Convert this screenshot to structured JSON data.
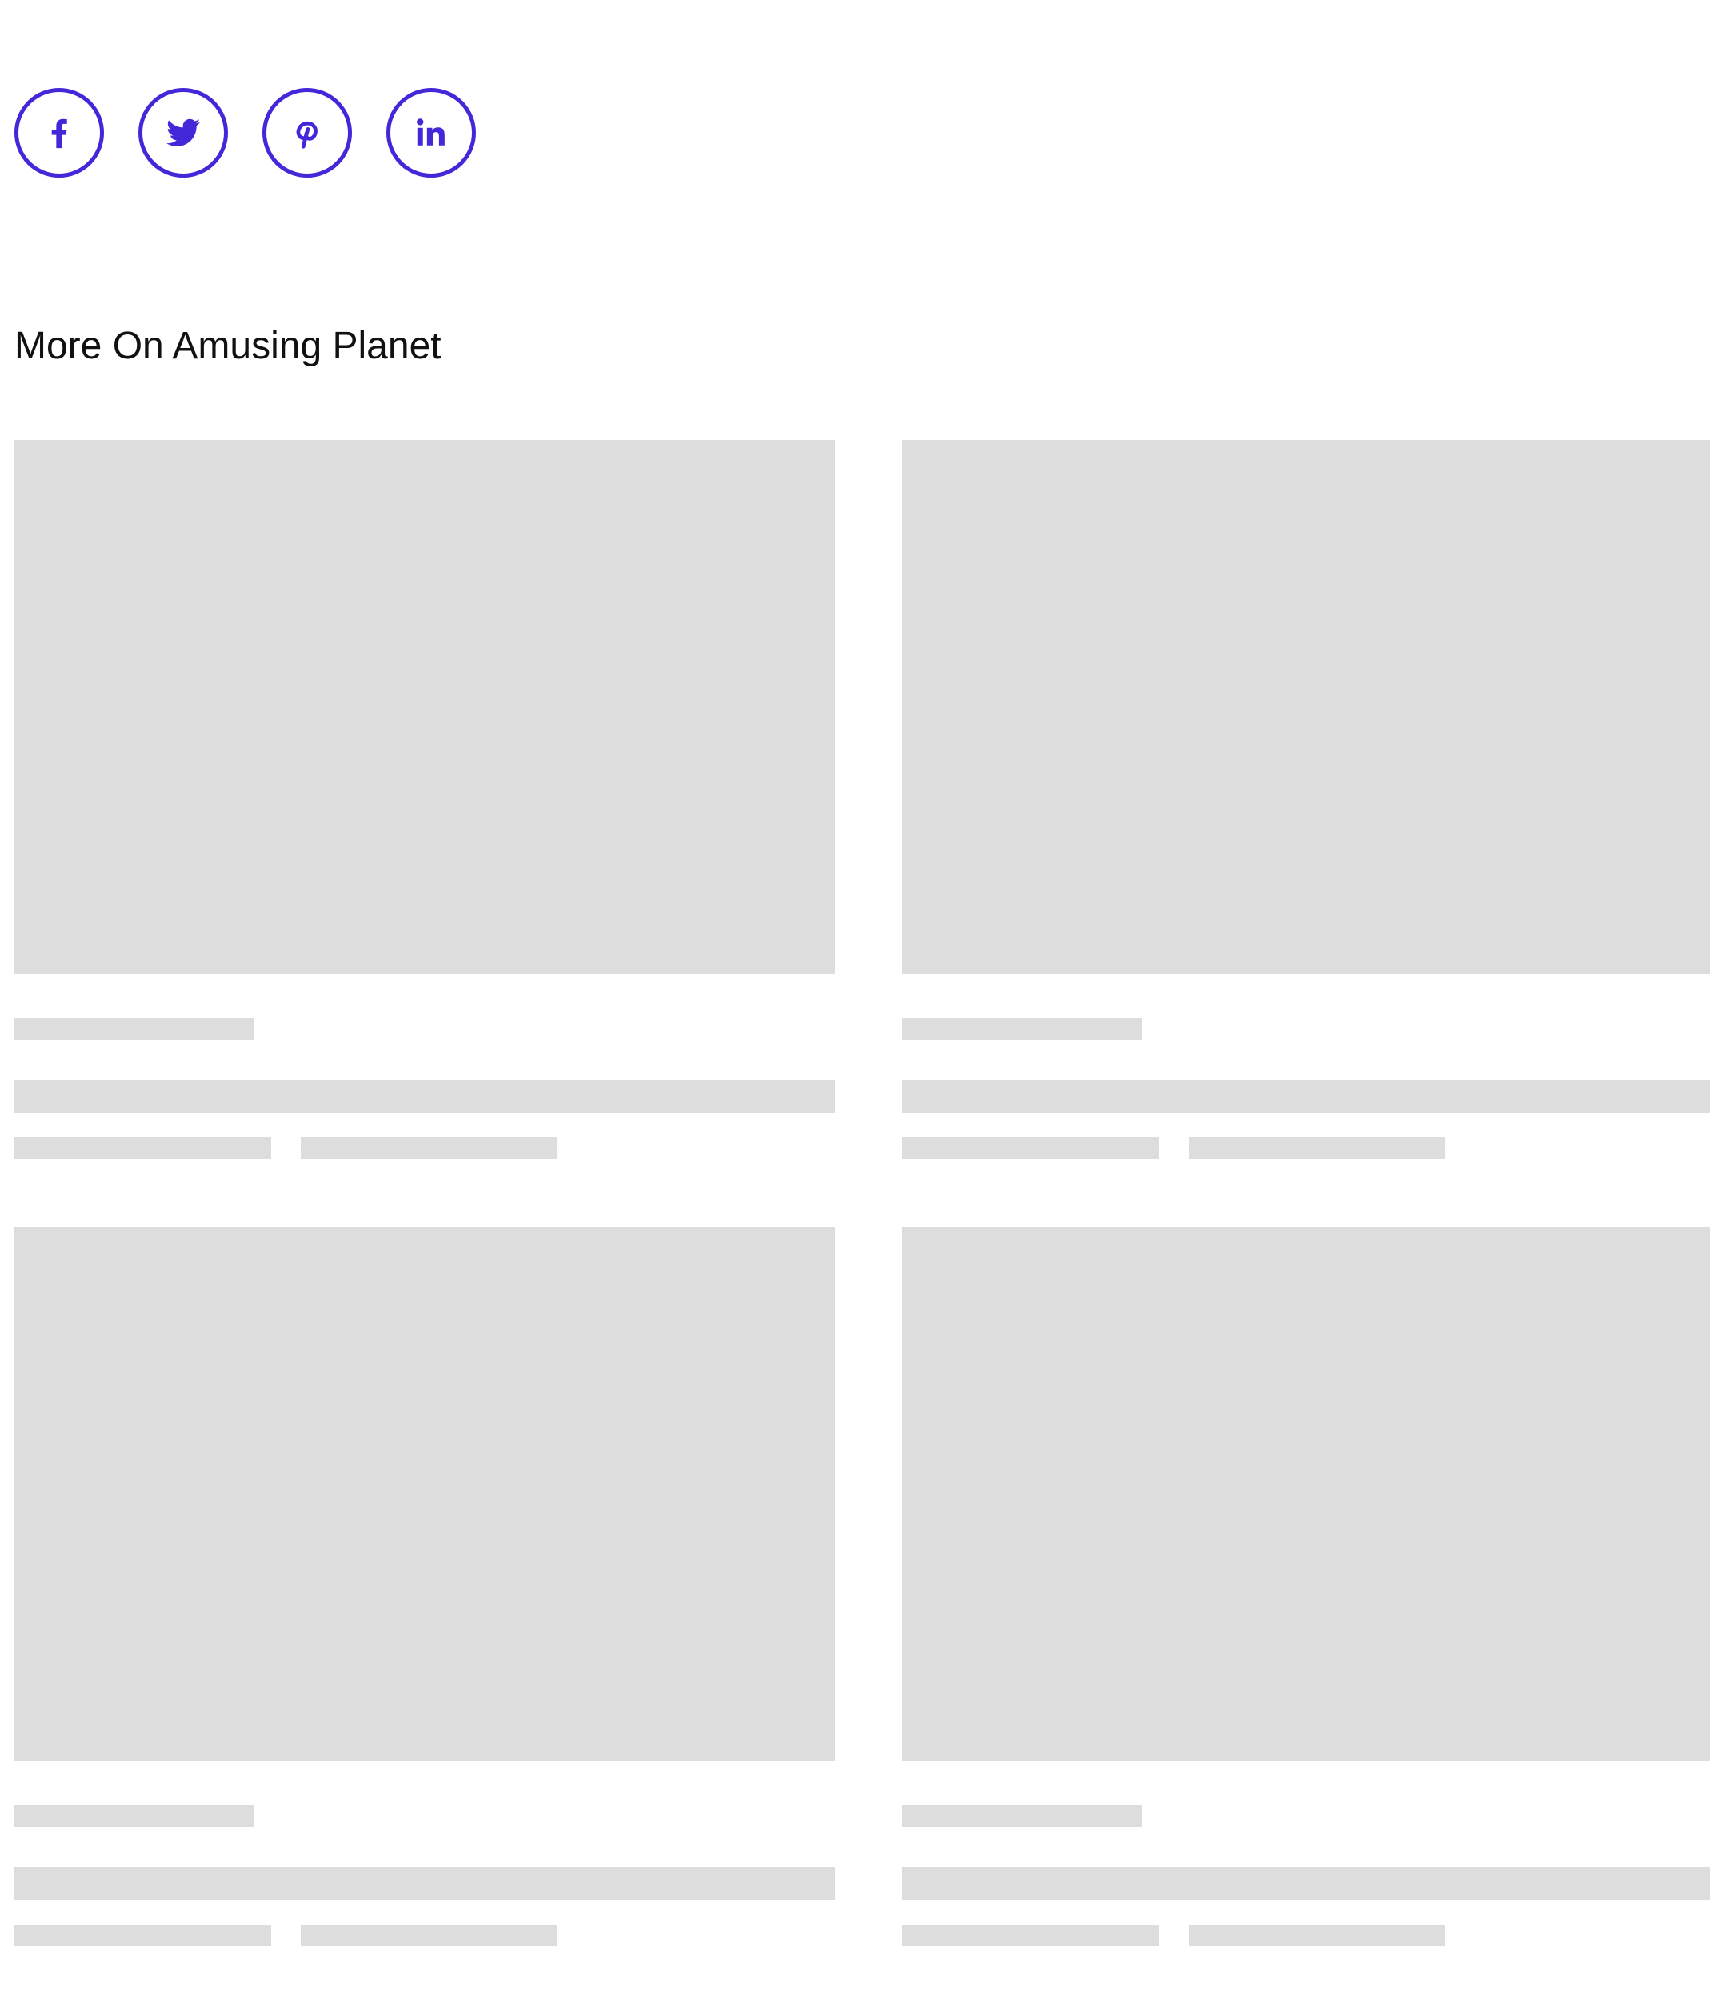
{
  "share": {
    "accent_color": "#4328d9",
    "buttons": [
      {
        "name": "facebook",
        "icon": "facebook-icon"
      },
      {
        "name": "twitter",
        "icon": "twitter-icon"
      },
      {
        "name": "pinterest",
        "icon": "pinterest-icon"
      },
      {
        "name": "linkedin",
        "icon": "linkedin-icon"
      }
    ]
  },
  "related": {
    "title": "More On Amusing Planet",
    "placeholder_color": "#dddddd",
    "cards_loading": true,
    "card_count": 4
  }
}
